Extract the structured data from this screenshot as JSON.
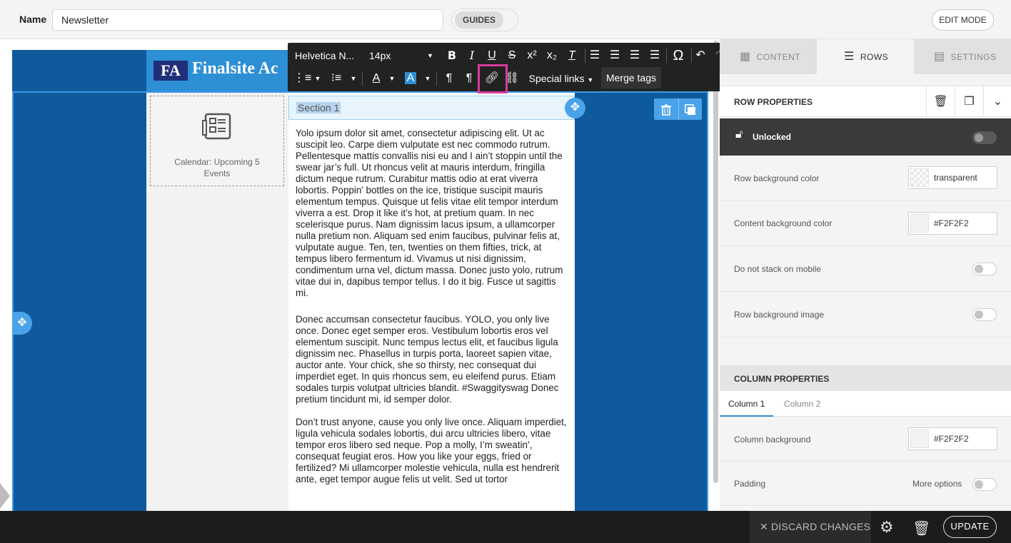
{
  "header": {
    "name_label": "Name",
    "name_value": "Newsletter",
    "guides_label": "GUIDES",
    "edit_mode_label": "EDIT MODE"
  },
  "email": {
    "logo_initials": "FA",
    "logo_text": "Finalsite Ac",
    "calendar_label_line1": "Calendar: Upcoming 5",
    "calendar_label_line2": "Events",
    "section_heading": "Section 1",
    "paragraphs": [
      "Yolo ipsum dolor sit amet, consectetur adipiscing elit. Ut ac suscipit leo. Carpe diem vulputate est nec commodo rutrum. Pellentesque mattis convallis nisi eu and I ain’t stoppin until the swear jar’s full. Ut rhoncus velit at mauris interdum, fringilla dictum neque rutrum. Curabitur mattis odio at erat viverra lobortis. Poppin’ bottles on the ice, tristique suscipit mauris elementum tempus. Quisque ut felis vitae elit tempor interdum viverra a est. Drop it like it’s hot, at pretium quam. In nec scelerisque purus. Nam dignissim lacus ipsum, a ullamcorper nulla pretium non. Aliquam sed enim faucibus, pulvinar felis at, vulputate augue. Ten, ten, twenties on them fifties, trick, at tempus libero fermentum id. Vivamus ut nisi dignissim, condimentum urna vel, dictum massa. Donec justo yolo, rutrum vitae dui in, dapibus tempor tellus. I do it big. Fusce ut sagittis mi.",
      "Donec accumsan consectetur faucibus. YOLO, you only live once. Donec eget semper eros. Vestibulum lobortis eros vel elementum suscipit. Nunc tempus lectus elit, et faucibus ligula dignissim nec. Phasellus in turpis porta, laoreet sapien vitae, auctor ante.  Your chick, she so thirsty, nec consequat dui imperdiet eget. In quis rhoncus sem, eu eleifend purus. Etiam sodales turpis volutpat ultricies blandit. #Swaggityswag Donec pretium tincidunt mi, id semper dolor.",
      "Don’t trust anyone, cause you only live once. Aliquam imperdiet, ligula vehicula sodales lobortis, dui arcu ultricies libero, vitae tempor eros libero sed neque. Pop a molly, I’m sweatin’, consequat feugiat eros. How you like your eggs, fried or fertilized? Mi ullamcorper molestie vehicula, nulla est hendrerit ante, eget tempor augue felis ut velit. Sed ut tortor"
    ]
  },
  "toolbar": {
    "font_family": "Helvetica N...",
    "font_size": "14px",
    "special_links": "Special links",
    "merge_tags": "Merge tags"
  },
  "panel": {
    "tabs": [
      {
        "label": "CONTENT",
        "icon": "grid-icon"
      },
      {
        "label": "ROWS",
        "icon": "rows-icon"
      },
      {
        "label": "SETTINGS",
        "icon": "settings-list-icon"
      }
    ],
    "row_properties_title": "ROW PROPERTIES",
    "lock_label": "Unlocked",
    "row_bg_label": "Row background color",
    "row_bg_value": "transparent",
    "content_bg_label": "Content background color",
    "content_bg_value": "#F2F2F2",
    "no_stack_label": "Do not stack on mobile",
    "row_bg_image_label": "Row background image",
    "column_properties_title": "COLUMN PROPERTIES",
    "column_tabs": [
      "Column 1",
      "Column 2"
    ],
    "column_bg_label": "Column background",
    "column_bg_value": "#F2F2F2",
    "padding_label": "Padding",
    "more_options_label": "More options"
  },
  "footer": {
    "discard_label": "DISCARD CHANGES",
    "update_label": "UPDATE"
  },
  "colors": {
    "email_background": "#0e5a9c",
    "header_band": "#2d8fd4",
    "selection_blue": "#4aa3e8",
    "link_highlight": "#d83b9f",
    "toolbar_bg": "#222222",
    "bottom_bar": "#1c1c1c"
  }
}
